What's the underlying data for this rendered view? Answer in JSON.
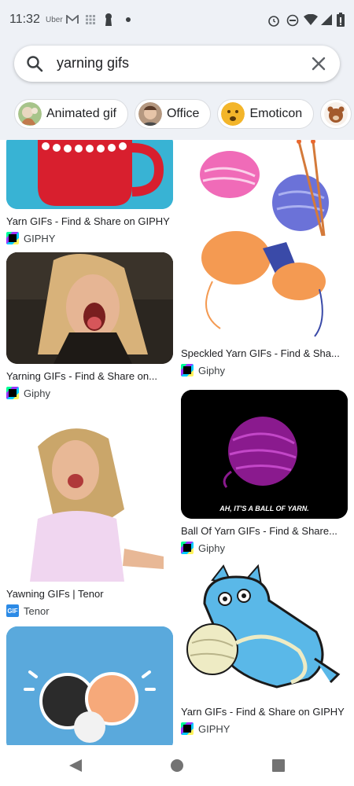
{
  "status_bar": {
    "time": "11:32",
    "notif_icons": [
      "Uber",
      "gmail-icon",
      "grid-icon",
      "keyhole-icon",
      "dot-icon"
    ],
    "uber_label": "Uber",
    "system_icons": [
      "alarm-icon",
      "dnd-icon",
      "wifi-icon",
      "signal-icon",
      "battery-icon"
    ]
  },
  "search": {
    "query": "yarning gifs"
  },
  "chips": [
    {
      "label": "Animated gif"
    },
    {
      "label": "Office"
    },
    {
      "label": "Emoticon"
    },
    {
      "label": ""
    }
  ],
  "results": [
    {
      "title": "Yarn GIFs - Find & Share on GIPHY",
      "source": "GIPHY",
      "fav": "giphy"
    },
    {
      "title": "Speckled Yarn GIFs - Find & Sha...",
      "source": "Giphy",
      "fav": "giphy"
    },
    {
      "title": "Yarning GIFs - Find & Share on...",
      "source": "Giphy",
      "fav": "giphy"
    },
    {
      "title": "Ball Of Yarn GIFs - Find & Share...",
      "source": "Giphy",
      "fav": "giphy",
      "caption": "AH, IT'S A BALL OF YARN."
    },
    {
      "title": "Yawning GIFs | Tenor",
      "source": "Tenor",
      "fav": "tenor",
      "fav_text": "GIF"
    },
    {
      "title": "Yarn GIFs - Find & Share on GIPHY",
      "source": "GIPHY",
      "fav": "giphy"
    },
    {
      "title": "",
      "source": "",
      "fav": ""
    }
  ],
  "colors": {
    "header_bg": "#eef1f6",
    "accent_blue": "#4285f4"
  }
}
